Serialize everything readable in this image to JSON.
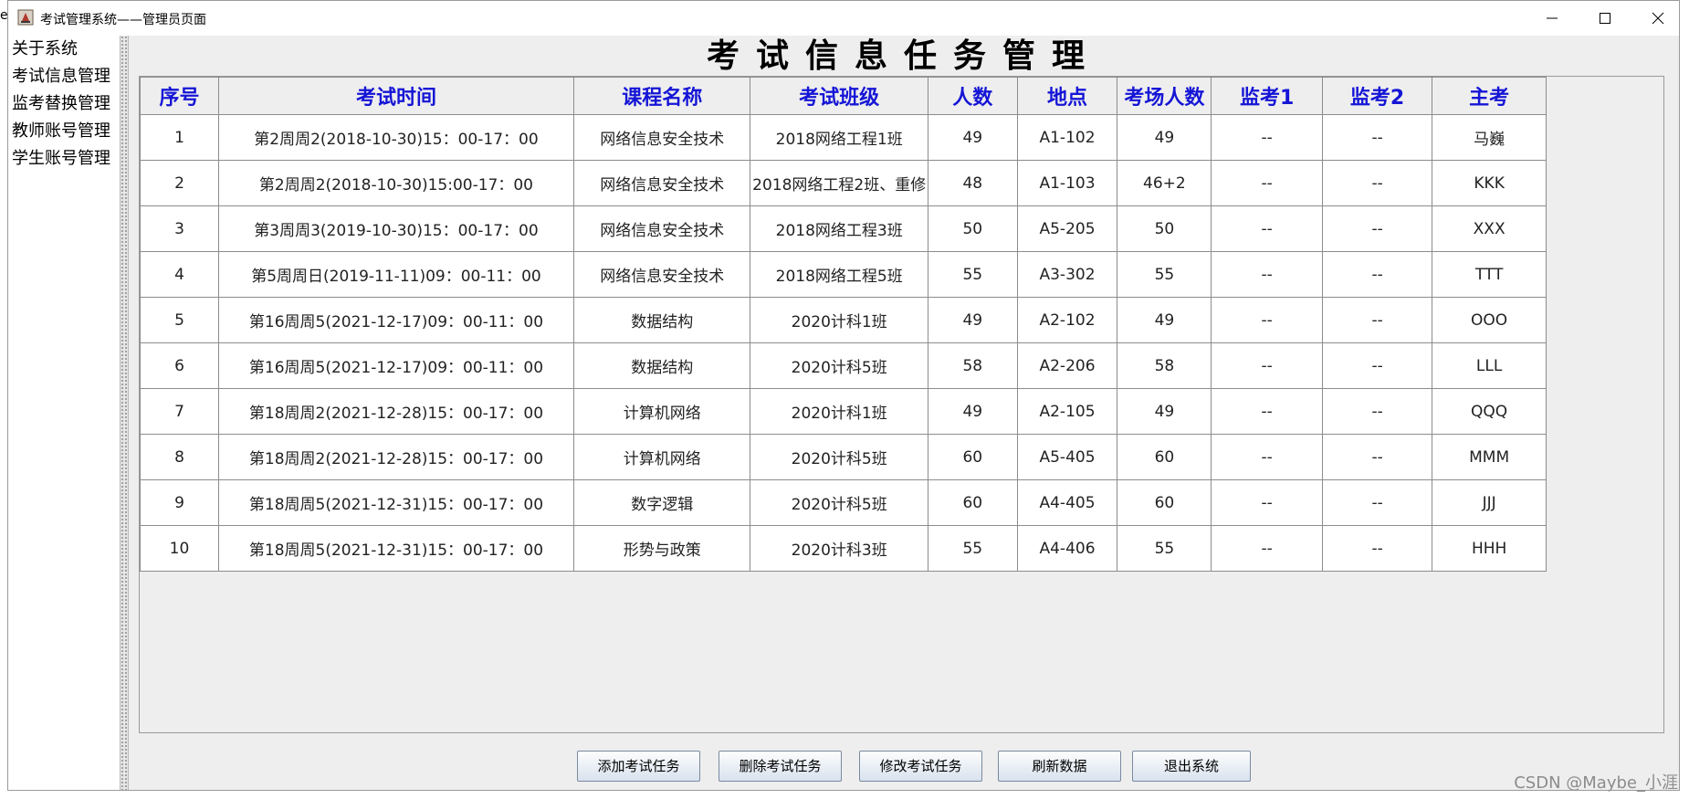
{
  "window": {
    "title": "考试管理系统——管理员页面",
    "edge_char": "e"
  },
  "sidebar": {
    "items": [
      {
        "label": "关于系统"
      },
      {
        "label": "考试信息管理"
      },
      {
        "label": "监考替换管理"
      },
      {
        "label": "教师账号管理"
      },
      {
        "label": "学生账号管理"
      }
    ]
  },
  "main": {
    "title": "考试信息任务管理"
  },
  "table": {
    "headers": [
      "序号",
      "考试时间",
      "课程名称",
      "考试班级",
      "人数",
      "地点",
      "考场人数",
      "监考1",
      "监考2",
      "主考"
    ],
    "rows": [
      [
        "1",
        "第2周周2(2018-10-30)15：00-17：00",
        "网络信息安全技术",
        "2018网络工程1班",
        "49",
        "A1-102",
        "49",
        "--",
        "--",
        "马巍"
      ],
      [
        "2",
        "第2周周2(2018-10-30)15:00-17：00",
        "网络信息安全技术",
        "2018网络工程2班、重修",
        "48",
        "A1-103",
        "46+2",
        "--",
        "--",
        "KKK"
      ],
      [
        "3",
        "第3周周3(2019-10-30)15：00-17：00",
        "网络信息安全技术",
        "2018网络工程3班",
        "50",
        "A5-205",
        "50",
        "--",
        "--",
        "XXX"
      ],
      [
        "4",
        "第5周周日(2019-11-11)09：00-11：00",
        "网络信息安全技术",
        "2018网络工程5班",
        "55",
        "A3-302",
        "55",
        "--",
        "--",
        "TTT"
      ],
      [
        "5",
        "第16周周5(2021-12-17)09：00-11：00",
        "数据结构",
        "2020计科1班",
        "49",
        "A2-102",
        "49",
        "--",
        "--",
        "OOO"
      ],
      [
        "6",
        "第16周周5(2021-12-17)09：00-11：00",
        "数据结构",
        "2020计科5班",
        "58",
        "A2-206",
        "58",
        "--",
        "--",
        "LLL"
      ],
      [
        "7",
        "第18周周2(2021-12-28)15：00-17：00",
        "计算机网络",
        "2020计科1班",
        "49",
        "A2-105",
        "49",
        "--",
        "--",
        "QQQ"
      ],
      [
        "8",
        "第18周周2(2021-12-28)15：00-17：00",
        "计算机网络",
        "2020计科5班",
        "60",
        "A5-405",
        "60",
        "--",
        "--",
        "MMM"
      ],
      [
        "9",
        "第18周周5(2021-12-31)15：00-17：00",
        "数字逻辑",
        "2020计科5班",
        "60",
        "A4-405",
        "60",
        "--",
        "--",
        "JJJ"
      ],
      [
        "10",
        "第18周周5(2021-12-31)15：00-17：00",
        "形势与政策",
        "2020计科3班",
        "55",
        "A4-406",
        "55",
        "--",
        "--",
        "HHH"
      ]
    ]
  },
  "buttons": {
    "add": "添加考试任务",
    "delete": "删除考试任务",
    "modify": "修改考试任务",
    "refresh": "刷新数据",
    "exit": "退出系统"
  },
  "watermark": "CSDN @Maybe_小涯",
  "colors": {
    "header_text": "#1515d6",
    "panel_bg": "#eeeeee",
    "grid": "#8c8c8c"
  }
}
